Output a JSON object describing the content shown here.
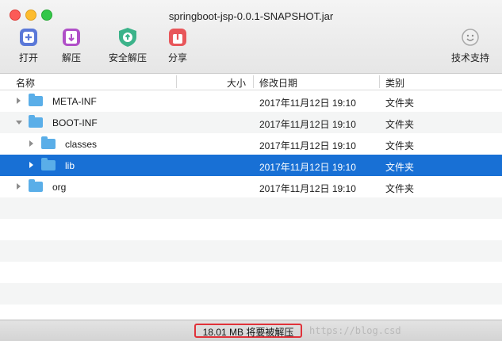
{
  "window": {
    "title": "springboot-jsp-0.0.1-SNAPSHOT.jar"
  },
  "toolbar": {
    "open": {
      "label": "打开",
      "icon": "open-icon"
    },
    "extract": {
      "label": "解压",
      "icon": "extract-icon"
    },
    "safe_extract": {
      "label": "安全解压",
      "icon": "safe-extract-icon"
    },
    "share": {
      "label": "分享",
      "icon": "share-icon"
    },
    "support": {
      "label": "技术支持",
      "icon": "support-icon"
    }
  },
  "columns": {
    "name": "名称",
    "size": "大小",
    "date": "修改日期",
    "kind": "类别"
  },
  "rows": [
    {
      "name": "META-INF",
      "date": "2017年11月12日 19:10",
      "kind": "文件夹"
    },
    {
      "name": "BOOT-INF",
      "date": "2017年11月12日 19:10",
      "kind": "文件夹"
    },
    {
      "name": "classes",
      "date": "2017年11月12日 19:10",
      "kind": "文件夹"
    },
    {
      "name": "lib",
      "date": "2017年11月12日 19:10",
      "kind": "文件夹"
    },
    {
      "name": "org",
      "date": "2017年11月12日 19:10",
      "kind": "文件夹"
    }
  ],
  "status": {
    "text": "18.01 MB 将要被解压",
    "watermark": "https://blog.csd"
  },
  "colors": {
    "selection": "#1870d5",
    "folder": "#5aaee8",
    "highlight_border": "#e0323a"
  }
}
